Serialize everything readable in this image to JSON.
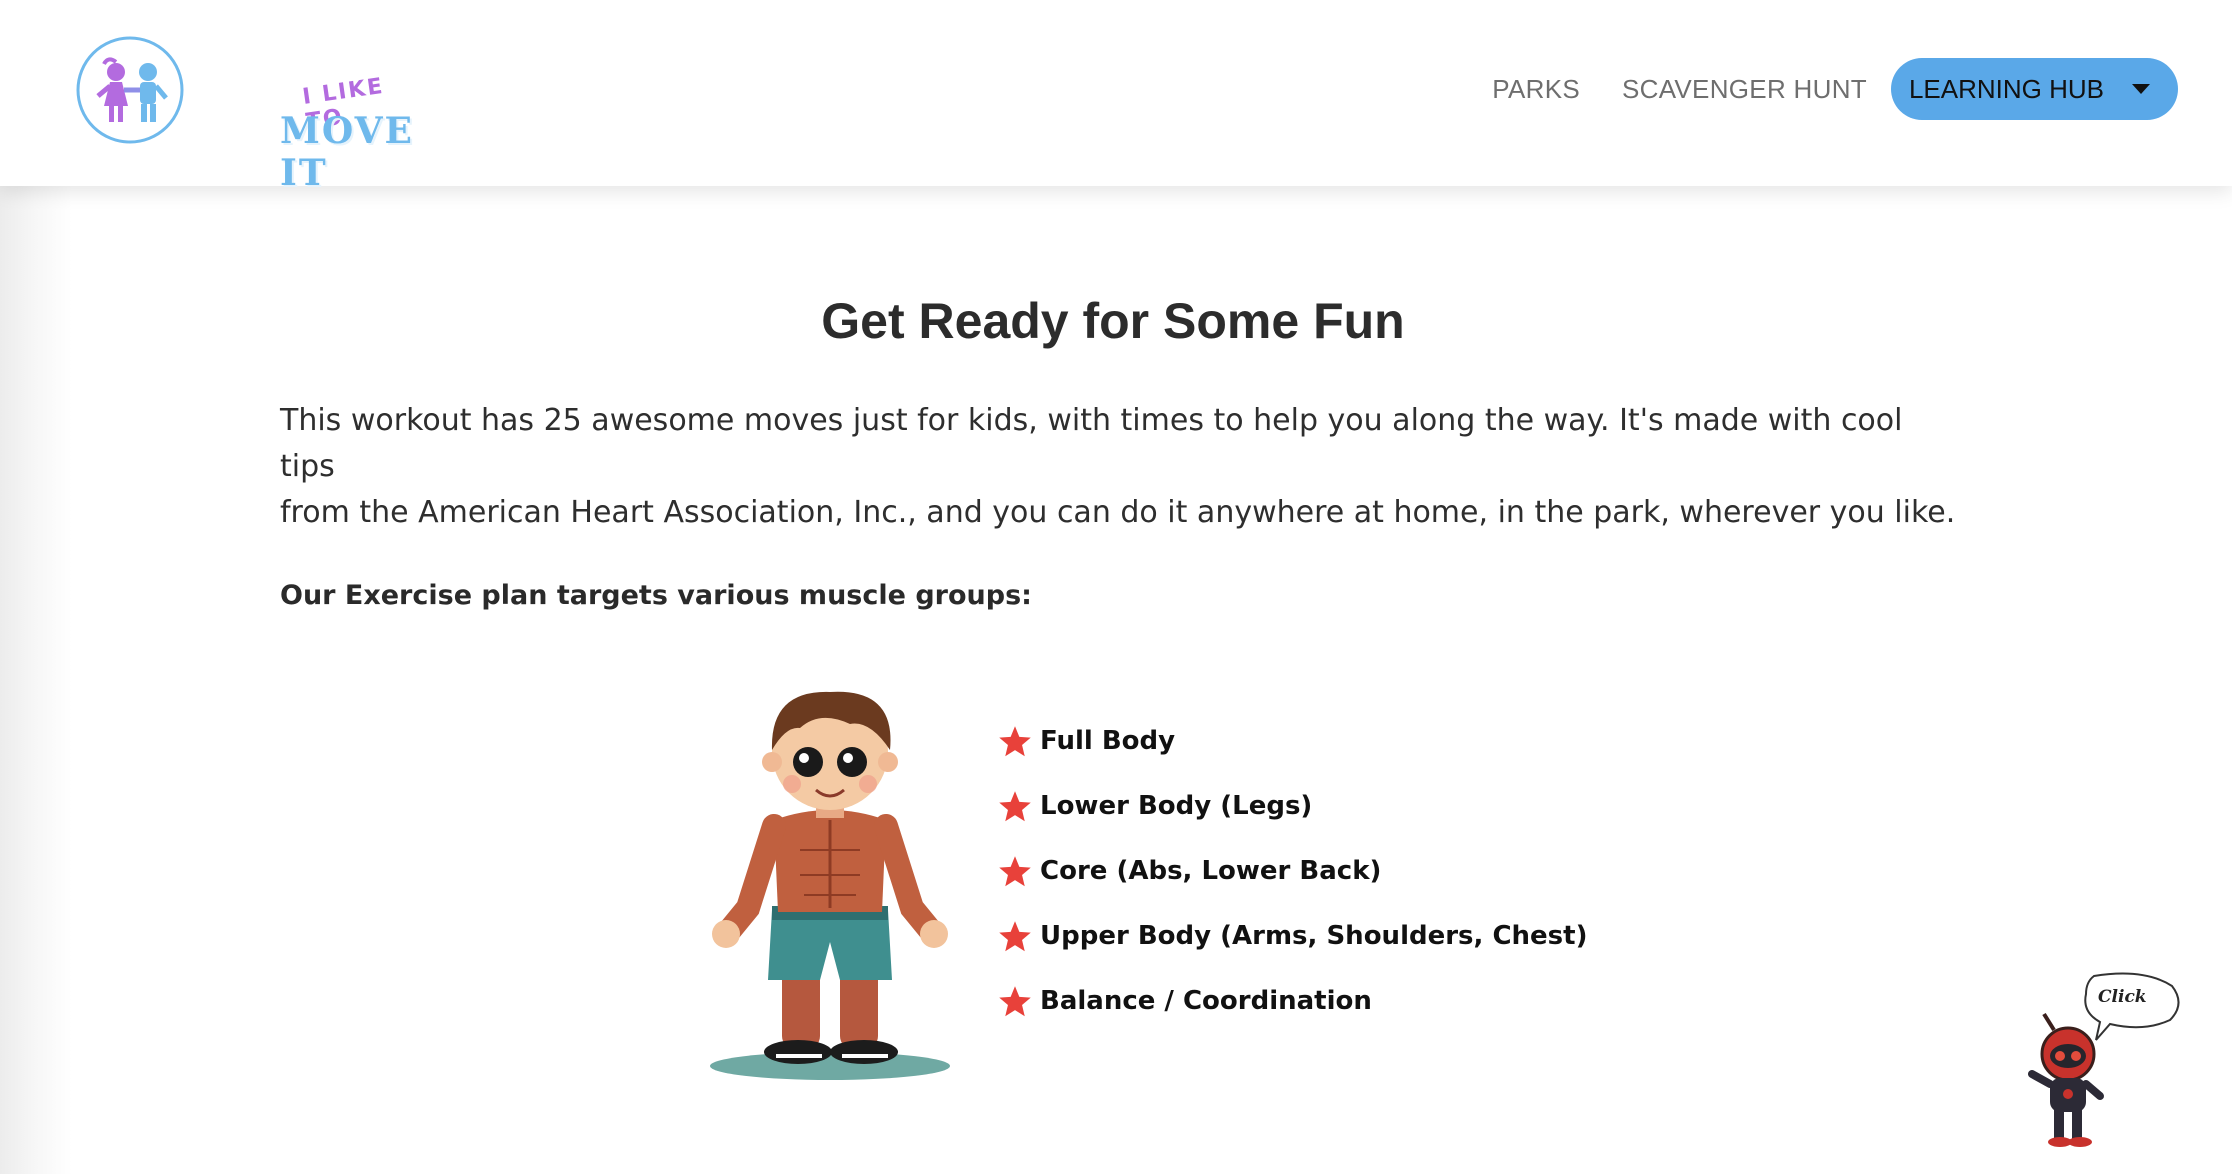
{
  "header": {
    "logo": {
      "tagline": "I LIKE TO",
      "name": "MOVE IT"
    },
    "nav": [
      {
        "label": "PARKS"
      },
      {
        "label": "SCAVENGER HUNT"
      }
    ],
    "dropdown": {
      "label": "LEARNING HUB",
      "icon": "chevron-down-icon"
    }
  },
  "main": {
    "title": "Get Ready for Some Fun",
    "intro_line1": "This workout has 25 awesome moves just for kids, with times to help you along the way. It's made with cool tips",
    "intro_line2": "from the American Heart Association, Inc., and you can do it anywhere at home, in the park, wherever you like.",
    "subheading": "Our Exercise plan targets various muscle groups:",
    "muscle_groups": [
      "Full Body",
      "Lower Body (Legs)",
      "Core (Abs, Lower Back)",
      "Upper Body (Arms, Shoulders, Chest)",
      "Balance / Coordination"
    ],
    "bullet_icon": "star-icon",
    "bullet_color": "#e8413a"
  },
  "mascot": {
    "bubble_text": "Click"
  },
  "colors": {
    "accent": "#5aa8e8",
    "logo_purple": "#b36bdf",
    "logo_blue": "#6fb9ec"
  }
}
